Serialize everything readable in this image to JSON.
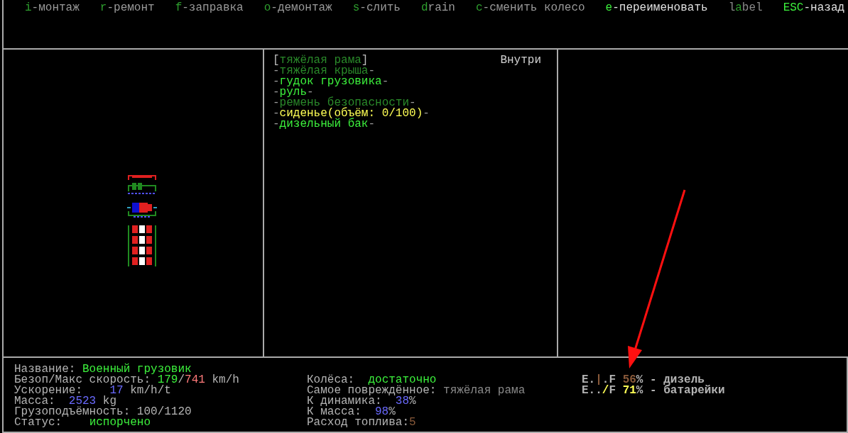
{
  "menu": [
    {
      "segments": [
        {
          "text": "i",
          "color": "#2e9e2e"
        },
        {
          "text": "-монтаж",
          "color": "#9a9a9a"
        }
      ]
    },
    {
      "segments": [
        {
          "text": "r",
          "color": "#2e9e2e"
        },
        {
          "text": "-ремонт",
          "color": "#9a9a9a"
        }
      ]
    },
    {
      "segments": [
        {
          "text": "f",
          "color": "#2e9e2e"
        },
        {
          "text": "-заправка",
          "color": "#9a9a9a"
        }
      ]
    },
    {
      "segments": [
        {
          "text": "o",
          "color": "#2e9e2e"
        },
        {
          "text": "-демонтаж",
          "color": "#9a9a9a"
        }
      ]
    },
    {
      "segments": [
        {
          "text": "s",
          "color": "#2e9e2e"
        },
        {
          "text": "-слить",
          "color": "#9a9a9a"
        }
      ]
    },
    {
      "segments": [
        {
          "text": "d",
          "color": "#2e9e2e"
        },
        {
          "text": "rain",
          "color": "#9a9a9a"
        }
      ]
    },
    {
      "segments": [
        {
          "text": "c",
          "color": "#2e9e2e"
        },
        {
          "text": "-сменить колесо",
          "color": "#9a9a9a"
        }
      ]
    },
    {
      "segments": [
        {
          "text": "e",
          "color": "#3cf03c"
        },
        {
          "text": "-переименовать",
          "color": "#e0e0e0"
        }
      ]
    },
    {
      "segments": [
        {
          "text": "l",
          "color": "#8a8a8a"
        },
        {
          "text": "a",
          "color": "#2e9e2e"
        },
        {
          "text": "bel",
          "color": "#8a8a8a"
        }
      ]
    },
    {
      "segments": [
        {
          "text": "ESC",
          "color": "#3cf03c"
        },
        {
          "text": "-назад",
          "color": "#e0e0e0"
        }
      ]
    }
  ],
  "parts_panel": {
    "location": "Внутри",
    "items": [
      {
        "segments": [
          {
            "text": "[",
            "color": "#bdbdbd"
          },
          {
            "text": "тяжёлая рама",
            "color": "#2a8a2a"
          },
          {
            "text": "]",
            "color": "#bdbdbd"
          }
        ]
      },
      {
        "segments": [
          {
            "text": "-",
            "color": "#9a9a9a"
          },
          {
            "text": "тяжёлая крыша",
            "color": "#2a8a2a"
          },
          {
            "text": "-",
            "color": "#9a9a9a"
          }
        ]
      },
      {
        "segments": [
          {
            "text": "-",
            "color": "#9a9a9a"
          },
          {
            "text": "гудок грузовика",
            "color": "#3cf03c"
          },
          {
            "text": "-",
            "color": "#9a9a9a"
          }
        ]
      },
      {
        "segments": [
          {
            "text": "-",
            "color": "#9a9a9a"
          },
          {
            "text": "руль",
            "color": "#3cf03c"
          },
          {
            "text": "-",
            "color": "#9a9a9a"
          }
        ]
      },
      {
        "segments": [
          {
            "text": "-",
            "color": "#9a9a9a"
          },
          {
            "text": "ремень безопасности",
            "color": "#2a8a2a"
          },
          {
            "text": "-",
            "color": "#9a9a9a"
          }
        ]
      },
      {
        "segments": [
          {
            "text": "-",
            "color": "#9a9a9a"
          },
          {
            "text": "сиденье(объём: 0/100)",
            "color": "#ffff55"
          },
          {
            "text": "-",
            "color": "#9a9a9a"
          }
        ]
      },
      {
        "segments": [
          {
            "text": "-",
            "color": "#9a9a9a"
          },
          {
            "text": "дизельный бак",
            "color": "#3cf03c"
          },
          {
            "text": "-",
            "color": "#9a9a9a"
          }
        ]
      }
    ]
  },
  "summary": {
    "columns": [
      {
        "lines": [
          {
            "segments": [
              {
                "text": "Название: ",
                "color": "#b4b4b4"
              },
              {
                "text": "Военный грузовик",
                "color": "#3cf03c"
              }
            ]
          },
          {
            "segments": [
              {
                "text": "Безоп/Макс скорость: ",
                "color": "#b4b4b4"
              },
              {
                "text": "179",
                "color": "#3cf03c"
              },
              {
                "text": "/",
                "color": "#b4b4b4"
              },
              {
                "text": "741",
                "color": "#ff7a7a"
              },
              {
                "text": " km/h",
                "color": "#b4b4b4"
              }
            ]
          },
          {
            "segments": [
              {
                "text": "Ускорение:    ",
                "color": "#b4b4b4"
              },
              {
                "text": "17",
                "color": "#6a6aff"
              },
              {
                "text": " km/h/t",
                "color": "#b4b4b4"
              }
            ]
          },
          {
            "segments": [
              {
                "text": "Масса:  ",
                "color": "#b4b4b4"
              },
              {
                "text": "2523",
                "color": "#6a6aff"
              },
              {
                "text": " kg",
                "color": "#b4b4b4"
              }
            ]
          },
          {
            "segments": [
              {
                "text": "Грузоподъёмность: 100/1120",
                "color": "#b4b4b4"
              }
            ]
          },
          {
            "segments": [
              {
                "text": "Статус:    ",
                "color": "#b4b4b4"
              },
              {
                "text": "испорчено",
                "color": "#3cf03c"
              }
            ]
          }
        ]
      },
      {
        "lines": [
          {
            "segments": [
              {
                "text": "Колёса:  ",
                "color": "#b4b4b4"
              },
              {
                "text": "достаточно",
                "color": "#3cf03c"
              }
            ]
          },
          {
            "segments": [
              {
                "text": "Самое повреждённое: ",
                "color": "#b4b4b4"
              },
              {
                "text": "тяжёлая рама",
                "color": "#8a8a8a"
              }
            ]
          },
          {
            "segments": [
              {
                "text": "К динамика:  ",
                "color": "#b4b4b4"
              },
              {
                "text": "38",
                "color": "#6a6aff"
              },
              {
                "text": "%",
                "color": "#b4b4b4"
              }
            ]
          },
          {
            "segments": [
              {
                "text": "К масса:  ",
                "color": "#b4b4b4"
              },
              {
                "text": "98",
                "color": "#6a6aff"
              },
              {
                "text": "%",
                "color": "#b4b4b4"
              }
            ]
          },
          {
            "segments": [
              {
                "text": "Расход топлива:",
                "color": "#b4b4b4"
              },
              {
                "text": "5",
                "color": "#8a5a3a"
              }
            ]
          }
        ]
      },
      {
        "lines": [
          {
            "segments": [
              {
                "text": "E.",
                "color": "#b4b4b4"
              },
              {
                "text": "|",
                "color": "#8a5a3a"
              },
              {
                "text": ".F ",
                "color": "#b4b4b4"
              },
              {
                "text": "56",
                "color": "#8a5a3a"
              },
              {
                "text": "% - дизель",
                "color": "#b4b4b4"
              }
            ]
          },
          {
            "segments": [
              {
                "text": "E..",
                "color": "#b4b4b4"
              },
              {
                "text": "/",
                "color": "#ffff55"
              },
              {
                "text": "F ",
                "color": "#b4b4b4"
              },
              {
                "text": "71",
                "color": "#ffff55"
              },
              {
                "text": "% - батарейки",
                "color": "#b4b4b4"
              }
            ]
          }
        ]
      }
    ]
  }
}
